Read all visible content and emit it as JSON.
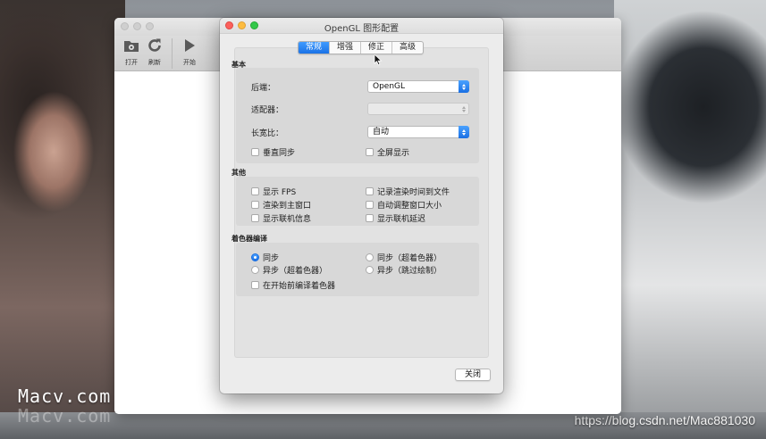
{
  "watermark": "Macv.com",
  "credit": "https://blog.csdn.net/Mac881030",
  "main_window": {
    "toolbar": [
      {
        "label": "打开",
        "icon": "open-folder-icon"
      },
      {
        "label": "刷新",
        "icon": "refresh-icon"
      },
      {
        "label": "开始",
        "icon": "play-icon"
      }
    ]
  },
  "dialog": {
    "title": "OpenGL 图形配置",
    "tabs": [
      "常规",
      "增强",
      "修正",
      "高级"
    ],
    "active_tab": "常规",
    "basic": {
      "title": "基本",
      "backend": {
        "label": "后端：",
        "value": "OpenGL"
      },
      "adapter": {
        "label": "适配器：",
        "value": ""
      },
      "aspect": {
        "label": "长宽比：",
        "value": "自动"
      },
      "vsync": {
        "label": "垂直同步",
        "checked": false
      },
      "fullscreen": {
        "label": "全屏显示",
        "checked": false
      }
    },
    "other": {
      "title": "其他",
      "show_fps": {
        "label": "显示 FPS",
        "checked": false
      },
      "log_render_time": {
        "label": "记录渲染时间到文件",
        "checked": false
      },
      "render_main_window": {
        "label": "渲染到主窗口",
        "checked": false
      },
      "auto_resize": {
        "label": "自动调整窗口大小",
        "checked": false
      },
      "show_netplay_info": {
        "label": "显示联机信息",
        "checked": false
      },
      "show_netplay_ping": {
        "label": "显示联机延迟",
        "checked": false
      }
    },
    "shader": {
      "title": "着色器编译",
      "sync": {
        "label": "同步",
        "selected": true
      },
      "sync_uber": {
        "label": "同步（超着色器）",
        "selected": false
      },
      "async_uber": {
        "label": "异步（超着色器）",
        "selected": false
      },
      "async_skip": {
        "label": "异步（跳过绘制）",
        "selected": false
      },
      "precompile": {
        "label": "在开始前编译着色器",
        "checked": false
      }
    },
    "close_label": "关闭"
  },
  "colors": {
    "accent": "#1b72e6",
    "close": "#fc605c",
    "minimize": "#fdbc40",
    "zoom": "#34c84a"
  }
}
